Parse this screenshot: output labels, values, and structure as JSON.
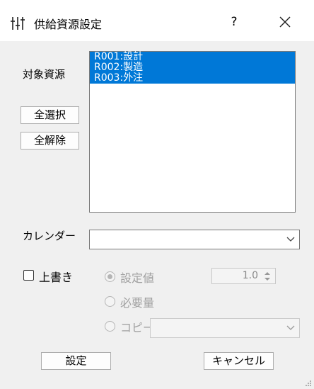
{
  "window": {
    "title": "供給資源設定",
    "help_label": "?",
    "icon": "sliders-icon",
    "close_icon": "close-icon"
  },
  "resources": {
    "label": "対象資源",
    "items": [
      "R001:設計",
      "R002:製造",
      "R003:外注"
    ],
    "select_all_label": "全選択",
    "clear_all_label": "全解除"
  },
  "calendar": {
    "label": "カレンダー",
    "value": ""
  },
  "overwrite": {
    "label": "上書き",
    "checked": false,
    "options": {
      "setting_value": "設定値",
      "required_amount": "必要量",
      "copy": "コピー"
    },
    "selected_option": "設定値",
    "value": "1.0",
    "copy_select_value": ""
  },
  "footer": {
    "ok_label": "設定",
    "cancel_label": "キャンセル"
  },
  "colors": {
    "selection": "#0078d7",
    "window_bg": "#f0f0f0",
    "disabled_text": "#a0a0a0"
  }
}
